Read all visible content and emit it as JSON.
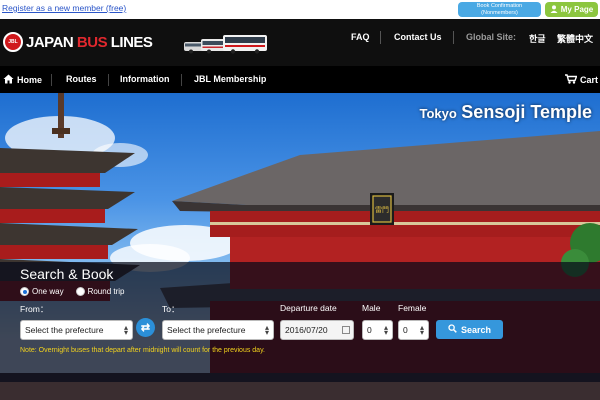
{
  "top": {
    "register_link": "Register as a new member (free)",
    "booking_btn_line1": "Book Confirmation",
    "booking_btn_line2": "(Nonmembers)",
    "mypage_btn": "My Page"
  },
  "header": {
    "logo_mark": "JBL",
    "logo_word1": "JAPAN",
    "logo_word2": "BUS",
    "logo_word3": "LINES",
    "links": {
      "faq": "FAQ",
      "contact": "Contact Us"
    },
    "global_site_label": "Global Site:",
    "languages": [
      "한글",
      "繁體中文"
    ]
  },
  "nav": {
    "items": [
      "Home",
      "Routes",
      "Information",
      "JBL Membership"
    ],
    "cart": "Cart"
  },
  "hero": {
    "caption_small": "Tokyo",
    "caption_big": "Sensoji Temple",
    "sign_text": "雷門"
  },
  "search": {
    "title": "Search & Book",
    "trip_types": [
      "One way",
      "Round trip"
    ],
    "trip_selected": "One way",
    "from_label": "From：",
    "to_label": "To：",
    "from_value": "Select the prefecture",
    "to_value": "Select the prefecture",
    "date_label": "Departure date",
    "date_value": "2016/07/20",
    "male_label": "Male",
    "male_value": "0",
    "female_label": "Female",
    "female_value": "0",
    "search_button": "Search",
    "note": "Note: Overnight buses that depart after midnight will count for the previous day."
  },
  "colors": {
    "header_bg": "#0f0f0f",
    "brand_red": "#e0282e",
    "accent_blue": "#3597dc",
    "mypage_green": "#8cc63f",
    "note_yellow": "#f2d21d"
  }
}
